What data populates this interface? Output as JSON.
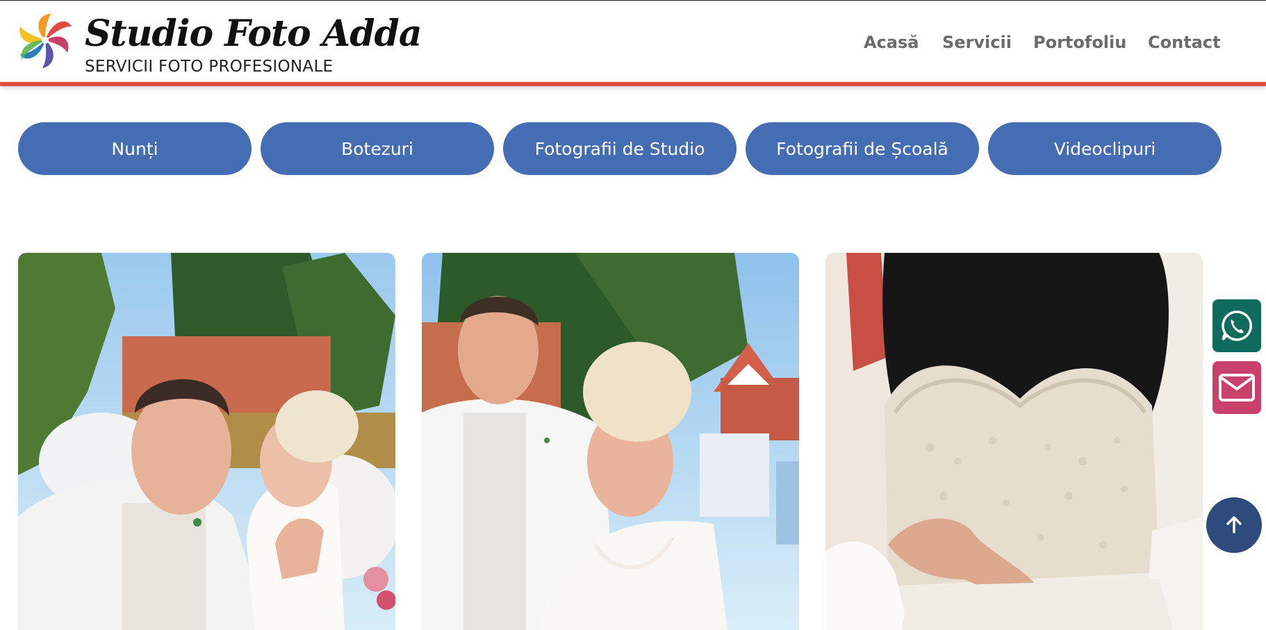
{
  "brand": {
    "title": "Studio Foto Adda",
    "subtitle": "SERVICII FOTO PROFESIONALE",
    "logo_icon": "camera-aperture-logo-icon"
  },
  "nav": {
    "items": [
      {
        "label": "Acasă"
      },
      {
        "label": "Servicii"
      },
      {
        "label": "Portofoliu"
      },
      {
        "label": "Contact"
      }
    ]
  },
  "categories": [
    {
      "label": "Nunți"
    },
    {
      "label": "Botezuri"
    },
    {
      "label": "Fotografii de Studio"
    },
    {
      "label": "Fotografii de Școală"
    },
    {
      "label": "Videoclipuri"
    }
  ],
  "gallery": {
    "items": [
      {
        "subject": "wedding couple outdoors, groom and bride smiling"
      },
      {
        "subject": "wedding couple portrait in front of trees and houses"
      },
      {
        "subject": "detail of beaded wedding dress bodice"
      }
    ]
  },
  "floating": {
    "whatsapp_icon": "whatsapp-icon",
    "mail_icon": "mail-icon",
    "back_to_top_icon": "arrow-up-icon"
  },
  "colors": {
    "accent_red": "#e24b43",
    "button_blue": "#456db4",
    "nav_gray": "#6b6b6b",
    "whatsapp_green": "#0f6b5e",
    "mail_pink": "#c9416b",
    "back_top_navy": "#2f4a7c"
  }
}
